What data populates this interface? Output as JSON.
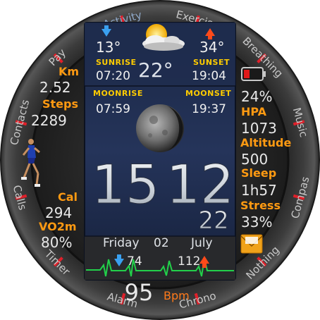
{
  "ring_items": [
    {
      "label": "Contacts",
      "color": "#c8c8c8"
    },
    {
      "label": "Pay",
      "color": "#c8c8c8"
    },
    {
      "label": "Activity",
      "color": "#8fa8c8"
    },
    {
      "label": "Exercise",
      "color": "#c8c8c8"
    },
    {
      "label": "Breathing",
      "color": "#c8c8c8"
    },
    {
      "label": "Music",
      "color": "#c8c8c8"
    },
    {
      "label": "Compas",
      "color": "#c8c8c8"
    },
    {
      "label": "Nothing",
      "color": "#c8c8c8"
    },
    {
      "label": "Chrono",
      "color": "#c8c8c8"
    },
    {
      "label": "Alarm",
      "color": "#c8c8c8"
    },
    {
      "label": "Timer",
      "color": "#c8c8c8"
    },
    {
      "label": "Calls",
      "color": "#c8c8c8"
    }
  ],
  "weather": {
    "min_temp": "13°",
    "max_temp": "34°",
    "current_temp": "22°",
    "sunrise_label": "SUNRISE",
    "sunrise_time": "07:20",
    "sunset_label": "SUNSET",
    "sunset_time": "19:04"
  },
  "moon": {
    "moonrise_label": "MOONRISE",
    "moonrise_time": "07:59",
    "moonset_label": "MOONSET",
    "moonset_time": "19:37"
  },
  "time": {
    "hours": "15",
    "minutes": "12",
    "seconds": "22"
  },
  "date": {
    "weekday": "Friday",
    "day": "02",
    "month": "July"
  },
  "heart": {
    "min": "74",
    "max": "112",
    "bpm": "95",
    "unit": "Bpm"
  },
  "left_stats": {
    "km_label": "Km",
    "km_value": "2.52",
    "steps_label": "Steps",
    "steps_value": "2289",
    "cal_label": "Cal",
    "cal_value": "294",
    "vo2_label": "VO2m",
    "vo2_value": "80%"
  },
  "right_stats": {
    "battery_value": "24%",
    "hpa_label": "HPA",
    "hpa_value": "1073",
    "altitude_label": "Altitude",
    "altitude_value": "500",
    "sleep_label": "Sleep",
    "sleep_value": "1h57",
    "stress_label": "Stress",
    "stress_value": "33%"
  },
  "colors": {
    "accent_orange": "#ff9a12",
    "label_yellow": "#ffcc00",
    "tick_red": "#e0202a",
    "arrow_blue": "#3aa0f0",
    "arrow_red": "#ff4a1a",
    "heart_green": "#22d04a",
    "bpm_orange": "#ff7a1a",
    "battery_red": "#e01818"
  },
  "icons": {
    "weather": "partly-cloudy-sun-icon",
    "battery": "battery-low-icon",
    "message": "envelope-icon",
    "runner": "runner-icon",
    "moon": "moon-phase-icon"
  }
}
